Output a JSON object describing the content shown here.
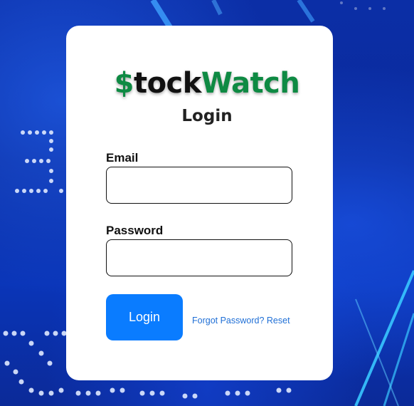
{
  "brand": {
    "dollar": "$",
    "tock": "tock",
    "watch": "Watch"
  },
  "login_form": {
    "title": "Login",
    "email_label": "Email",
    "email_value": "",
    "password_label": "Password",
    "password_value": "",
    "submit_label": "Login",
    "forgot_link": "Forgot Password? Reset"
  },
  "colors": {
    "brand_green": "#0e8a43",
    "button_blue": "#0a7cff",
    "link_blue": "#1f6fd6",
    "background_blue": "#0a2fa8"
  }
}
